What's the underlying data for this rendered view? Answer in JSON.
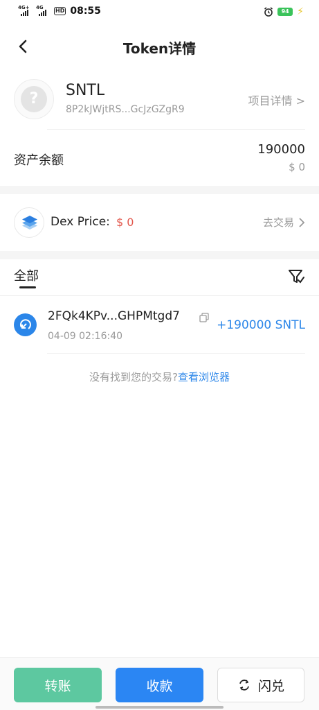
{
  "status_bar": {
    "network1": "4G+",
    "network2": "4G",
    "hd": "HD",
    "time": "08:55",
    "battery": "94"
  },
  "header": {
    "title": "Token详情"
  },
  "token": {
    "symbol": "SNTL",
    "address": "8P2kJWjtRS...GcJzGZgR9",
    "project_detail": "项目详情 >"
  },
  "balance": {
    "label": "资产余额",
    "amount": "190000",
    "value": "$ 0"
  },
  "dex": {
    "label": "Dex Price:",
    "price": "$ 0",
    "action": "去交易"
  },
  "tabs": {
    "all": "全部"
  },
  "transactions": [
    {
      "hash": "2FQk4KPv...GHPMtgd7",
      "time": "04-09 02:16:40",
      "amount": "+190000 SNTL"
    }
  ],
  "not_found": {
    "text": "没有找到您的交易?",
    "link": "查看浏览器"
  },
  "bottom": {
    "transfer": "转账",
    "receive": "收款",
    "flash": "闪兑"
  },
  "colors": {
    "accent_blue": "#2b86e9",
    "transfer_green": "#5dc8a0",
    "price_red": "#e2574c"
  }
}
